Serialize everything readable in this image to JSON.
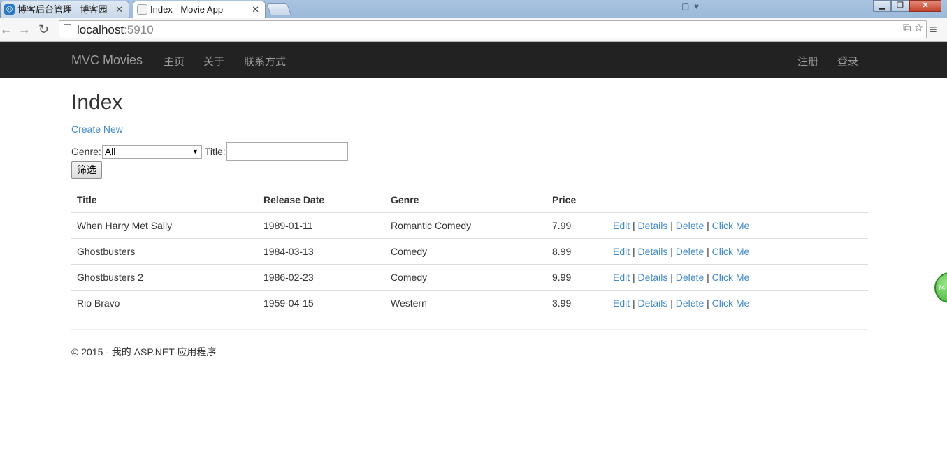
{
  "browser": {
    "tabs": [
      {
        "label": "博客后台管理 - 博客园",
        "favicon": "cnblogs-icon"
      },
      {
        "label": "Index - Movie App",
        "favicon": "page-icon"
      }
    ],
    "url_host": "localhost",
    "url_port": ":5910"
  },
  "navbar": {
    "brand": "MVC Movies",
    "links": [
      "主页",
      "关于",
      "联系方式"
    ],
    "right_links": [
      "注册",
      "登录"
    ]
  },
  "page": {
    "title": "Index",
    "create_link": "Create New",
    "genre_label": "Genre:",
    "genre_selected": "All",
    "title_label": "Title:",
    "title_value": "",
    "filter_button": "筛选"
  },
  "table": {
    "headers": [
      "Title",
      "Release Date",
      "Genre",
      "Price"
    ],
    "rows": [
      {
        "title": "When Harry Met Sally",
        "date": "1989-01-11",
        "genre": "Romantic Comedy",
        "price": "7.99"
      },
      {
        "title": "Ghostbusters",
        "date": "1984-03-13",
        "genre": "Comedy",
        "price": "8.99"
      },
      {
        "title": "Ghostbusters 2",
        "date": "1986-02-23",
        "genre": "Comedy",
        "price": "9.99"
      },
      {
        "title": "Rio Bravo",
        "date": "1959-04-15",
        "genre": "Western",
        "price": "3.99"
      }
    ],
    "actions": {
      "edit": "Edit",
      "details": "Details",
      "delete": "Delete",
      "click": "Click Me",
      "separator": "|"
    }
  },
  "footer": {
    "text": "© 2015 - 我的 ASP.NET 应用程序"
  },
  "floating_badge": "74",
  "colors": {
    "navbar_bg": "#222222",
    "navbar_text": "#9d9d9d",
    "link": "#428bca"
  }
}
